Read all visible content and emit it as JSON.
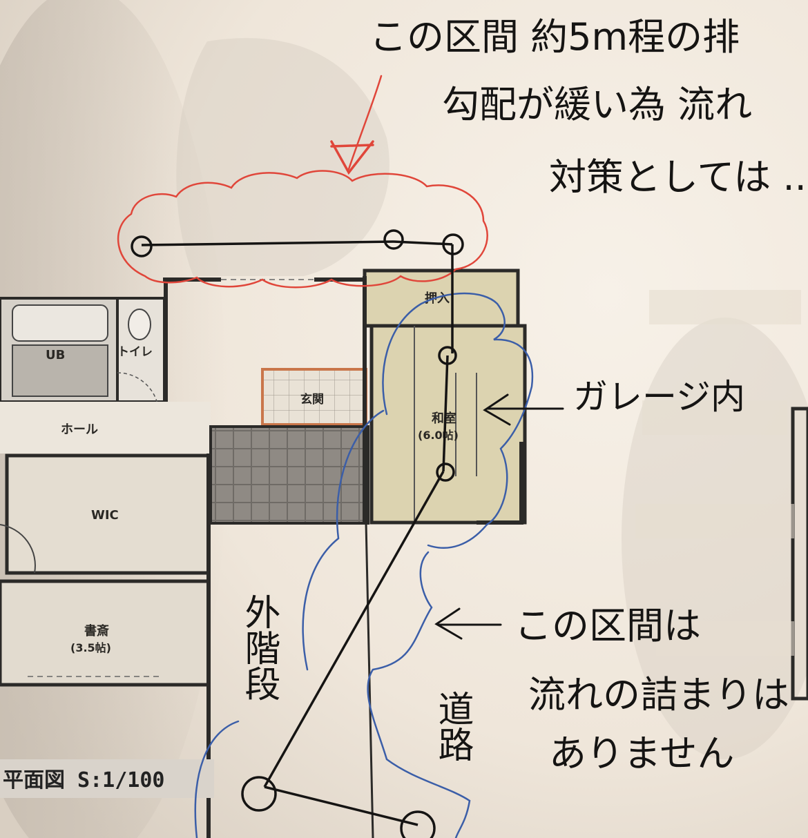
{
  "plan": {
    "rooms": {
      "oshiire": "押入",
      "ub": "UB",
      "toilet": "トイレ",
      "genkan": "玄関",
      "washitsu": "和室",
      "washitsu_size": "(6.0帖)",
      "hall": "ホール",
      "wic": "WIC",
      "shosai": "書斎",
      "shosai_size": "(3.5帖)"
    },
    "scale": "平面図 S:1/100"
  },
  "notes": {
    "top_line1": "この区間 約5m程の排",
    "top_line2": "勾配が緩い為 流れ",
    "top_line3": "対策としては ...",
    "garage": "ガレージ内",
    "mid_line1": "この区間は",
    "mid_line2": "流れの詰まりは",
    "mid_line3": "ありません",
    "outside_stairs": "外階段",
    "road": "道路"
  },
  "colors": {
    "paper": "#f3ece2",
    "shadow": "#cfc6ba",
    "red_pen": "#e0463a",
    "blue_pen": "#3b5ea8",
    "ink": "#151413",
    "tatami": "#dcd3b0"
  }
}
